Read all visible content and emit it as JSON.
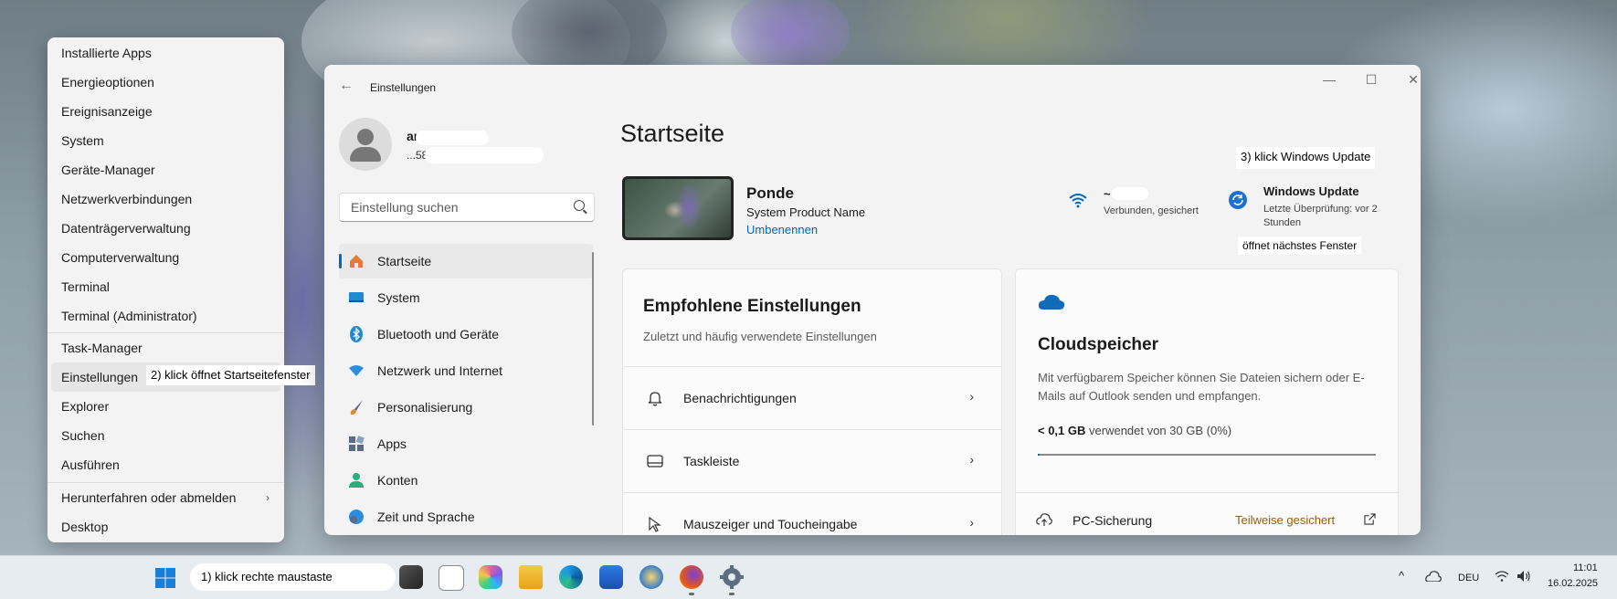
{
  "context_menu": {
    "items": [
      {
        "label": "Installierte Apps"
      },
      {
        "label": "Energieoptionen"
      },
      {
        "label": "Ereignisanzeige"
      },
      {
        "label": "System"
      },
      {
        "label": "Geräte-Manager"
      },
      {
        "label": "Netzwerkverbindungen"
      },
      {
        "label": "Datenträgerverwaltung"
      },
      {
        "label": "Computerverwaltung"
      },
      {
        "label": "Terminal"
      },
      {
        "label": "Terminal (Administrator)"
      },
      {
        "label": "Task-Manager"
      },
      {
        "label": "Einstellungen"
      },
      {
        "label": "Explorer"
      },
      {
        "label": "Suchen"
      },
      {
        "label": "Ausführen"
      },
      {
        "label": "Herunterfahren oder abmelden"
      },
      {
        "label": "Desktop"
      }
    ],
    "submenu_glyph": "›"
  },
  "annotations": {
    "step1": "1) klick rechte maustaste",
    "step2": "2) klick öffnet Startseitefenster",
    "step3": "3) klick Windows Update",
    "step3b": "öffnet nächstes Fenster"
  },
  "window": {
    "title": "Einstellungen",
    "back_glyph": "←",
    "controls": {
      "minimize": "—",
      "maximize": "☐",
      "close": "✕"
    }
  },
  "user": {
    "name": "an...",
    "email": "...58@gm..."
  },
  "search": {
    "placeholder": "Einstellung suchen"
  },
  "nav": {
    "items": [
      {
        "label": "Startseite",
        "active": true,
        "color": "#e07b39"
      },
      {
        "label": "System",
        "active": false,
        "color": "#1f8ad2"
      },
      {
        "label": "Bluetooth und Geräte",
        "active": false,
        "color": "#1f8ad2"
      },
      {
        "label": "Netzwerk und Internet",
        "active": false,
        "color": "#2a8de0"
      },
      {
        "label": "Personalisierung",
        "active": false,
        "color": "#e0883a"
      },
      {
        "label": "Apps",
        "active": false,
        "color": "#5a6b86"
      },
      {
        "label": "Konten",
        "active": false,
        "color": "#24b07a"
      },
      {
        "label": "Zeit und Sprache",
        "active": false,
        "color": "#2a8de0"
      }
    ]
  },
  "main": {
    "title": "Startseite",
    "device": {
      "name": "Ponde",
      "model": "System Product Name",
      "rename": "Umbenennen"
    },
    "network": {
      "name": "~",
      "status": "Verbunden, gesichert"
    },
    "update": {
      "title": "Windows Update",
      "subtitle": "Letzte Überprüfung: vor 2 Stunden"
    }
  },
  "recommended": {
    "title": "Empfohlene Einstellungen",
    "subtitle": "Zuletzt und häufig verwendete Einstellungen",
    "rows": [
      {
        "label": "Benachrichtigungen",
        "icon": "bell-icon"
      },
      {
        "label": "Taskleiste",
        "icon": "taskbar-icon"
      },
      {
        "label": "Mauszeiger und Toucheingabe",
        "icon": "cursor-icon"
      }
    ],
    "chevron": "›"
  },
  "cloud": {
    "title": "Cloudspeicher",
    "description": "Mit verfügbarem Speicher können Sie Dateien sichern oder E-Mails auf Outlook senden und empfangen.",
    "used": "< 0,1 GB",
    "used_suffix": "verwendet von 30 GB (0%)",
    "progress_fraction": 0.005,
    "backup_label": "PC-Sicherung",
    "backup_status": "Teilweise gesichert",
    "backup_status_color": "#9a5a00"
  },
  "taskbar": {
    "tray": {
      "language": "DEU",
      "time": "11:01",
      "date": "16.02.2025",
      "chevron": "^"
    }
  },
  "colors": {
    "accent": "#0067c0"
  }
}
